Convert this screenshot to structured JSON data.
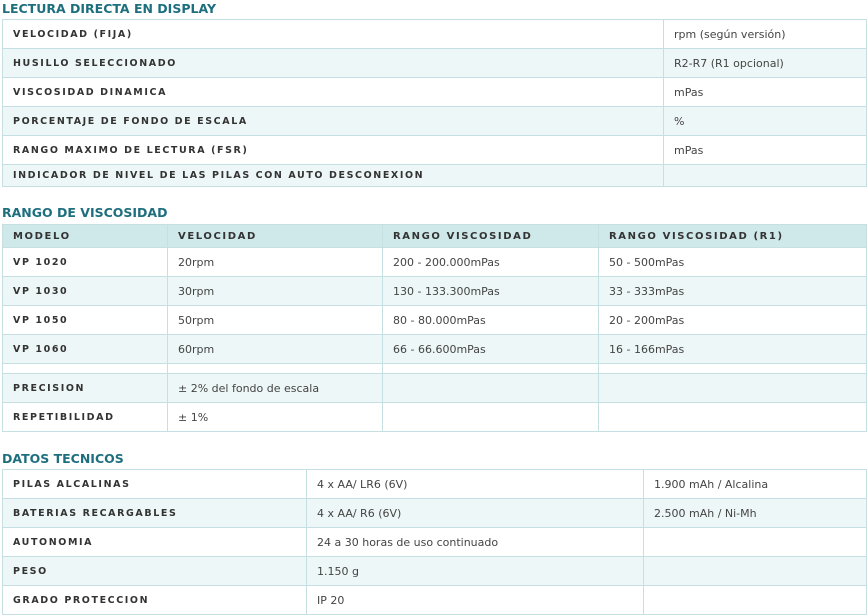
{
  "lectura": {
    "title": "LECTURA DIRECTA EN DISPLAY",
    "rows": [
      {
        "label": "VELOCIDAD (FIJA)",
        "value": "rpm (según versión)"
      },
      {
        "label": "HUSILLO SELECCIONADO",
        "value": "R2-R7 (R1 opcional)"
      },
      {
        "label": "VISCOSIDAD DINAMICA",
        "value": "mPas"
      },
      {
        "label": "PORCENTAJE DE FONDO DE ESCALA",
        "value": "%"
      },
      {
        "label": "RANGO MAXIMO DE LECTURA (FSR)",
        "value": "mPas"
      },
      {
        "label": "INDICADOR DE NIVEL DE LAS PILAS CON AUTO DESCONEXION",
        "value": ""
      }
    ]
  },
  "rango": {
    "title": "RANGO DE VISCOSIDAD",
    "headers": [
      "MODELO",
      "VELOCIDAD",
      "RANGO VISCOSIDAD",
      "RANGO VISCOSIDAD (R1)"
    ],
    "rows": [
      [
        "VP 1020",
        "20rpm",
        "200 - 200.000mPas",
        "50 - 500mPas"
      ],
      [
        "VP 1030",
        "30rpm",
        "130 - 133.300mPas",
        "33 - 333mPas"
      ],
      [
        "VP 1050",
        "50rpm",
        "80 - 80.000mPas",
        "20 - 200mPas"
      ],
      [
        "VP 1060",
        "60rpm",
        "66 - 66.600mPas",
        "16 - 166mPas"
      ],
      [
        "",
        "",
        "",
        ""
      ],
      [
        "PRECISION",
        "± 2% del fondo de escala",
        "",
        ""
      ],
      [
        "REPETIBILIDAD",
        "± 1%",
        "",
        ""
      ]
    ]
  },
  "datos": {
    "title": "DATOS TECNICOS",
    "rows": [
      [
        "PILAS ALCALINAS",
        "4 x AA/ LR6 (6V)",
        "1.900 mAh / Alcalina"
      ],
      [
        "BATERIAS RECARGABLES",
        "4 x AA/ R6 (6V)",
        "2.500 mAh / Ni-Mh"
      ],
      [
        "AUTONOMIA",
        "24 a 30 horas de uso continuado",
        ""
      ],
      [
        "PESO",
        "1.150 g",
        ""
      ],
      [
        "GRADO PROTECCION",
        "IP 20",
        ""
      ]
    ]
  }
}
